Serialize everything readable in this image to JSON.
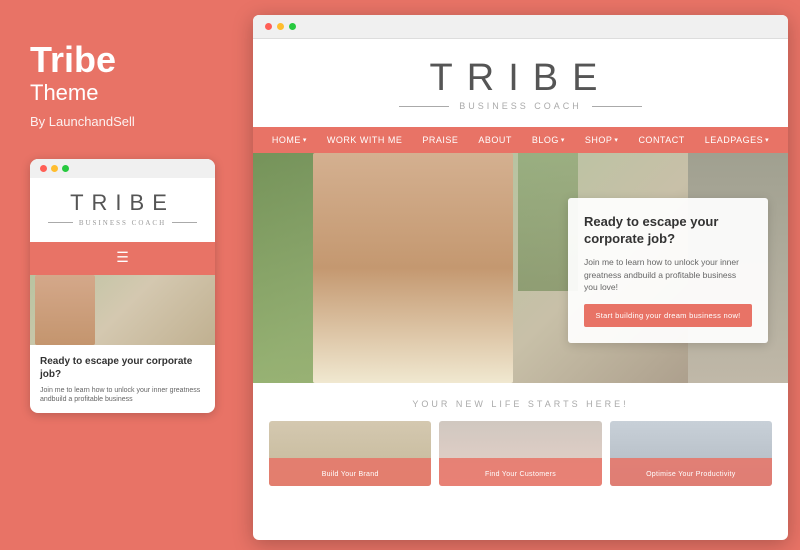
{
  "left": {
    "title": "Tribe",
    "subtitle": "Theme",
    "byline": "By LaunchandSell"
  },
  "mobile": {
    "logo": "TRIBE",
    "tagline": "BUSINESS COACH",
    "heading": "Ready to escape your corporate job?",
    "body": "Join me to learn how to unlock your inner greatness andbuild a profitable business"
  },
  "desktop": {
    "logo": "TRIBE",
    "tagline": "BUSINESS COACH",
    "nav": [
      {
        "label": "HOME",
        "has_arrow": true
      },
      {
        "label": "WORK WITH ME",
        "has_arrow": false
      },
      {
        "label": "PRAISE",
        "has_arrow": false
      },
      {
        "label": "ABOUT",
        "has_arrow": false
      },
      {
        "label": "BLOG",
        "has_arrow": true
      },
      {
        "label": "SHOP",
        "has_arrow": true
      },
      {
        "label": "CONTACT",
        "has_arrow": false
      },
      {
        "label": "LEADPAGES",
        "has_arrow": true
      }
    ],
    "hero_cta": {
      "title": "Ready to escape your corporate job?",
      "body": "Join me to learn how to unlock your inner greatness andbuild a profitable business you love!",
      "button": "Start building your dream business now!"
    },
    "section_label": "YOUR NEW LIFE STARTS HERE!",
    "cards": [
      {
        "label": "Build Your Brand"
      },
      {
        "label": "Find Your Customers"
      },
      {
        "label": "Optimise Your Productivity"
      }
    ]
  },
  "browser": {
    "dots": [
      "red",
      "yellow",
      "green"
    ]
  }
}
